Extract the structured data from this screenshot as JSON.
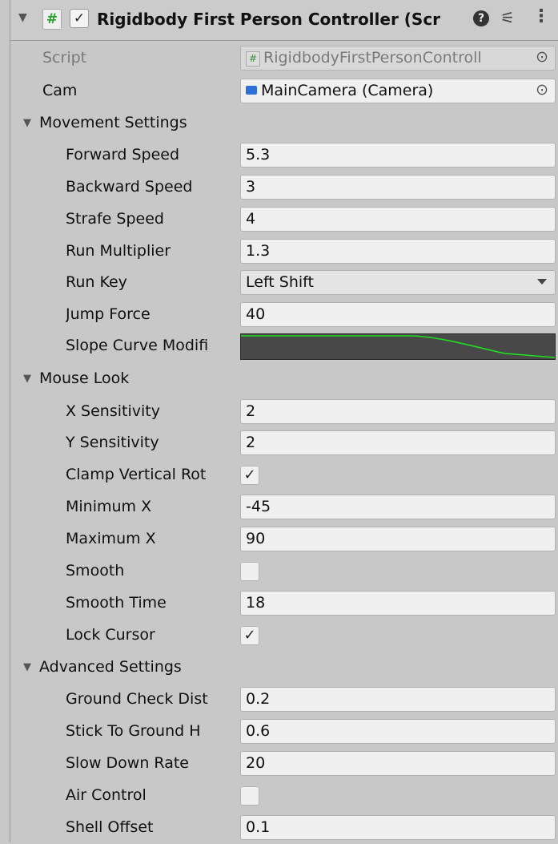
{
  "component": {
    "title": "Rigidbody First Person Controller (Scr",
    "enabled_check": "✓",
    "script_icon": "#",
    "help_icon": "?",
    "presets_icon": "⚟",
    "menu_icon": "⋮",
    "fold_icon": "▼"
  },
  "script": {
    "label": "Script",
    "value": "RigidbodyFirstPersonControll",
    "picker": "⊙"
  },
  "cam": {
    "label": "Cam",
    "value": "MainCamera (Camera)",
    "picker": "⊙"
  },
  "movement": {
    "label": "Movement Settings",
    "forward_speed": {
      "label": "Forward Speed",
      "value": "5.3"
    },
    "backward_speed": {
      "label": "Backward Speed",
      "value": "3"
    },
    "strafe_speed": {
      "label": "Strafe Speed",
      "value": "4"
    },
    "run_multiplier": {
      "label": "Run Multiplier",
      "value": "1.3"
    },
    "run_key": {
      "label": "Run Key",
      "value": "Left Shift"
    },
    "jump_force": {
      "label": "Jump Force",
      "value": "40"
    },
    "slope_curve": {
      "label": "Slope Curve Modifi",
      "curve_color": "#22dd22"
    }
  },
  "mouse_look": {
    "label": "Mouse Look",
    "x_sensitivity": {
      "label": "X Sensitivity",
      "value": "2"
    },
    "y_sensitivity": {
      "label": "Y Sensitivity",
      "value": "2"
    },
    "clamp_vertical": {
      "label": "Clamp Vertical Rot",
      "checked": "✓"
    },
    "minimum_x": {
      "label": "Minimum X",
      "value": "-45"
    },
    "maximum_x": {
      "label": "Maximum X",
      "value": "90"
    },
    "smooth": {
      "label": "Smooth",
      "checked": ""
    },
    "smooth_time": {
      "label": "Smooth Time",
      "value": "18"
    },
    "lock_cursor": {
      "label": "Lock Cursor",
      "checked": "✓"
    }
  },
  "advanced": {
    "label": "Advanced Settings",
    "ground_check": {
      "label": "Ground Check Dist",
      "value": "0.2"
    },
    "stick_to_ground": {
      "label": "Stick To Ground H",
      "value": "0.6"
    },
    "slow_down_rate": {
      "label": "Slow Down Rate",
      "value": "20"
    },
    "air_control": {
      "label": "Air Control",
      "checked": ""
    },
    "shell_offset": {
      "label": "Shell Offset",
      "value": "0.1"
    }
  }
}
